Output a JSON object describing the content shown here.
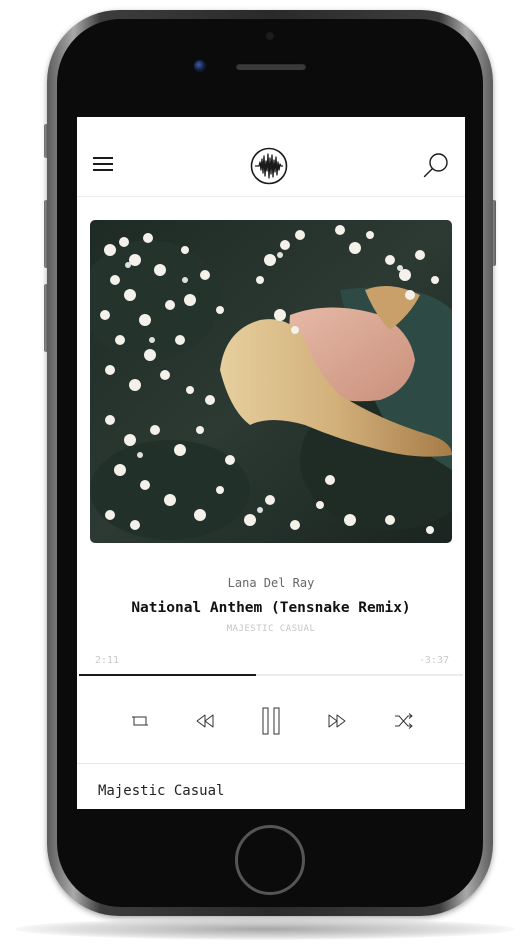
{
  "app": {
    "logo_icon": "waveform-logo-icon",
    "menu_icon": "hamburger-menu-icon",
    "search_icon": "search-icon"
  },
  "now_playing": {
    "artist": "Lana Del Ray",
    "title": "National Anthem (Tensnake Remix)",
    "album": "MAJESTIC CASUAL",
    "elapsed": "2:11",
    "remaining": "-3:37",
    "progress": 0.46
  },
  "controls": {
    "repeat_icon": "repeat-icon",
    "rewind_icon": "rewind-icon",
    "pause_icon": "pause-icon",
    "forward_icon": "fast-forward-icon",
    "shuffle_icon": "shuffle-icon"
  },
  "queue": {
    "channel_name": "Majestic Casual"
  },
  "colors": {
    "accent": "#1a1a1a",
    "muted_text": "#c4c4c4",
    "bezel": "#0b0b0b"
  }
}
